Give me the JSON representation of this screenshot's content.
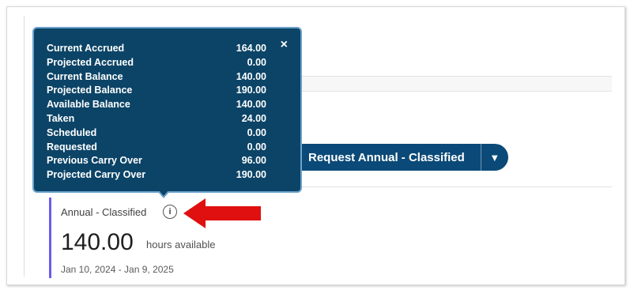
{
  "tooltip": {
    "close_label": "×",
    "rows": [
      {
        "label": "Current Accrued",
        "value": "164.00"
      },
      {
        "label": "Projected Accrued",
        "value": "0.00"
      },
      {
        "label": "Current Balance",
        "value": "140.00"
      },
      {
        "label": "Projected Balance",
        "value": "190.00"
      },
      {
        "label": "Available Balance",
        "value": "140.00"
      },
      {
        "label": "Taken",
        "value": "24.00"
      },
      {
        "label": "Scheduled",
        "value": "0.00"
      },
      {
        "label": "Requested",
        "value": "0.00"
      },
      {
        "label": "Previous Carry Over",
        "value": "96.00"
      },
      {
        "label": "Projected Carry Over",
        "value": "190.00"
      }
    ]
  },
  "request_button": {
    "label": "Request Annual - Classified",
    "caret": "▼"
  },
  "card": {
    "title": "Annual - Classified",
    "info_icon": "i",
    "hours": "140.00",
    "hours_label": "hours available",
    "date_range": "Jan 10, 2024 - Jan 9, 2025"
  },
  "colors": {
    "tooltip_bg": "#0c4467",
    "tooltip_border": "#6da3cc",
    "button_bg": "#0b4a78",
    "card_accent": "#6a5cf0",
    "arrow": "#e01010"
  },
  "icons": {
    "info": "info-circle-icon",
    "close": "close-icon",
    "caret": "chevron-down-icon",
    "annotation": "red-arrow-left-icon"
  }
}
